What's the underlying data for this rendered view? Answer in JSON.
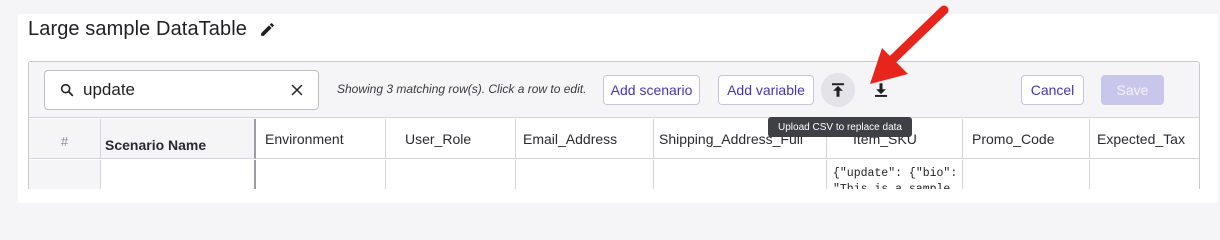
{
  "page": {
    "title": "Large sample DataTable"
  },
  "toolbar": {
    "search": {
      "value": "update",
      "placeholder": ""
    },
    "match_text": "Showing 3 matching row(s). Click a row to edit.",
    "add_scenario_label": "Add scenario",
    "add_variable_label": "Add variable",
    "cancel_label": "Cancel",
    "save_label": "Save",
    "upload_tooltip": "Upload CSV to replace data"
  },
  "table": {
    "columns": [
      "#",
      "Scenario Name",
      "Environment",
      "User_Role",
      "Email_Address",
      "Shipping_Address_Full",
      "Item_SKU",
      "Promo_Code",
      "Expected_Tax"
    ],
    "rows": [
      {
        "cells": [
          "",
          "",
          "",
          "",
          "",
          "",
          "{\"update\": {\"bio\":\n\"This is a sample",
          "",
          ""
        ]
      }
    ]
  },
  "colors": {
    "accent": "#4536b5",
    "save_disabled": "#c9c6ec",
    "annotation_arrow": "#e8251c",
    "tooltip_bg": "#3f3f46"
  },
  "icons": [
    "edit-pencil-icon",
    "search-icon",
    "clear-icon",
    "upload-icon",
    "download-icon"
  ]
}
